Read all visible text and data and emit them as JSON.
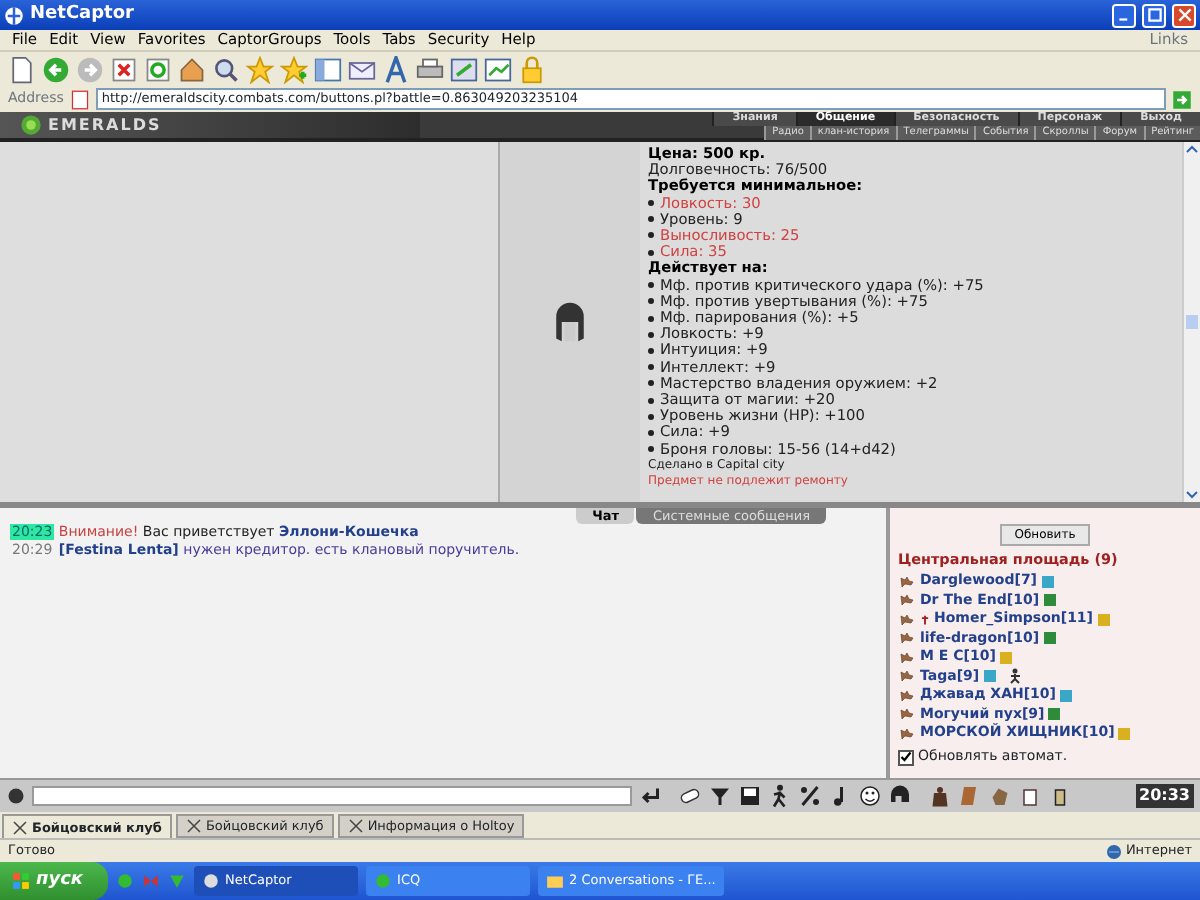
{
  "window": {
    "title": "NetCaptor"
  },
  "menu": [
    "File",
    "Edit",
    "View",
    "Favorites",
    "CaptorGroups",
    "Tools",
    "Tabs",
    "Security",
    "Help"
  ],
  "links_label": "Links",
  "address": {
    "label": "Address",
    "value": "http://emeraldscity.combats.com/buttons.pl?battle=0.863049203235104"
  },
  "game": {
    "logo": "EMERALDS",
    "nav_top": [
      {
        "label": "Знания",
        "selected": false
      },
      {
        "label": "Общение",
        "selected": true
      },
      {
        "label": "Безопасность",
        "selected": false
      },
      {
        "label": "Персонаж",
        "selected": false
      },
      {
        "label": "Выход",
        "selected": false
      }
    ],
    "nav_sub": [
      "Радио",
      "клан-история",
      "Телеграммы",
      "События",
      "Скроллы",
      "Форум",
      "Рейтинг"
    ]
  },
  "item": {
    "lines": [
      {
        "kind": "header",
        "text": "Цена: 500 кр."
      },
      {
        "kind": "plain",
        "text": "Долговечность: 76/500"
      },
      {
        "kind": "header",
        "text": "Требуется минимальное:"
      },
      {
        "kind": "bullet",
        "text": "Ловкость: 30",
        "unmet": true
      },
      {
        "kind": "bullet",
        "text": "Уровень: 9",
        "unmet": false
      },
      {
        "kind": "bullet",
        "text": "Выносливость: 25",
        "unmet": true
      },
      {
        "kind": "bullet",
        "text": "Сила: 35",
        "unmet": true
      },
      {
        "kind": "header",
        "text": "Действует на:"
      },
      {
        "kind": "bullet",
        "text": "Мф. против критического удара (%): +75",
        "unmet": false
      },
      {
        "kind": "bullet",
        "text": "Мф. против увертывания (%): +75",
        "unmet": false
      },
      {
        "kind": "bullet",
        "text": "Мф. парирования (%): +5",
        "unmet": false
      },
      {
        "kind": "bullet",
        "text": "Ловкость: +9",
        "unmet": false
      },
      {
        "kind": "bullet",
        "text": "Интуиция: +9",
        "unmet": false
      },
      {
        "kind": "bullet",
        "text": "Интеллект: +9",
        "unmet": false
      },
      {
        "kind": "bullet",
        "text": "Мастерство владения оружием: +2",
        "unmet": false
      },
      {
        "kind": "bullet",
        "text": "Защита от магии: +20",
        "unmet": false
      },
      {
        "kind": "bullet",
        "text": "Уровень жизни (HP): +100",
        "unmet": false
      },
      {
        "kind": "bullet",
        "text": "Сила: +9",
        "unmet": false
      },
      {
        "kind": "bullet",
        "text": "Броня головы: 15-56 (14+d42)",
        "unmet": false
      },
      {
        "kind": "note",
        "text": "Сделано в Capital city"
      },
      {
        "kind": "warning",
        "text": "Предмет не подлежит ремонту"
      }
    ]
  },
  "chat_tabs": [
    {
      "label": "Чат",
      "selected": true
    },
    {
      "label": "Системные сообщения",
      "selected": false
    }
  ],
  "chat": [
    {
      "time": "20:23",
      "highlighted": true,
      "parts": [
        {
          "kind": "alert",
          "text": "Внимание!"
        },
        {
          "kind": "plain",
          "text": "Вас приветствует"
        },
        {
          "kind": "nick",
          "text": "Эллони-Кошечка"
        }
      ]
    },
    {
      "time": "20:29",
      "highlighted": false,
      "parts": [
        {
          "kind": "nick",
          "text": "[Festina Lenta]"
        },
        {
          "kind": "message",
          "text": "нужен кредитор. есть клановый поручитель."
        }
      ]
    }
  ],
  "users": {
    "refresh_button": "Обновить",
    "location": "Центральная площадь (9)",
    "list": [
      {
        "name": "Darglewood[7]",
        "color": "#3aa6c8",
        "cross": false,
        "figure": false
      },
      {
        "name": "Dr The End[10]",
        "color": "#2e8b3a",
        "cross": false,
        "figure": false
      },
      {
        "name": "Homer_Simpson[11]",
        "color": "#d8b020",
        "cross": true,
        "figure": false
      },
      {
        "name": "life-dragon[10]",
        "color": "#2e8b3a",
        "cross": false,
        "figure": false
      },
      {
        "name": "M E C[10]",
        "color": "#d8b020",
        "cross": false,
        "figure": false
      },
      {
        "name": "Taga[9]",
        "color": "#3aa6c8",
        "cross": false,
        "figure": true
      },
      {
        "name": "Джавад ХАН[10]",
        "color": "#3aa6c8",
        "cross": false,
        "figure": false
      },
      {
        "name": "Могучий пух[9]",
        "color": "#2e8b3a",
        "cross": false,
        "figure": false
      },
      {
        "name": "МОРСКОЙ ХИЩНИК[10]",
        "color": "#d8b020",
        "cross": false,
        "figure": false
      }
    ],
    "auto_refresh": {
      "label": "Обновлять автомат.",
      "checked": true
    }
  },
  "clock": "20:33",
  "browser_tabs": [
    {
      "label": "Бойцовский клуб",
      "selected": true
    },
    {
      "label": "Бойцовский клуб",
      "selected": false
    },
    {
      "label": "Информация о Holtoy",
      "selected": false
    }
  ],
  "status_bar": {
    "text": "Готово",
    "zone": "Интернет"
  },
  "taskbar": {
    "start": "пуск",
    "windows": [
      {
        "label": "NetCaptor",
        "selected": true
      },
      {
        "label": "ICQ",
        "selected": false
      },
      {
        "label": "2 Conversations - ГЕ...",
        "selected": false
      }
    ]
  }
}
